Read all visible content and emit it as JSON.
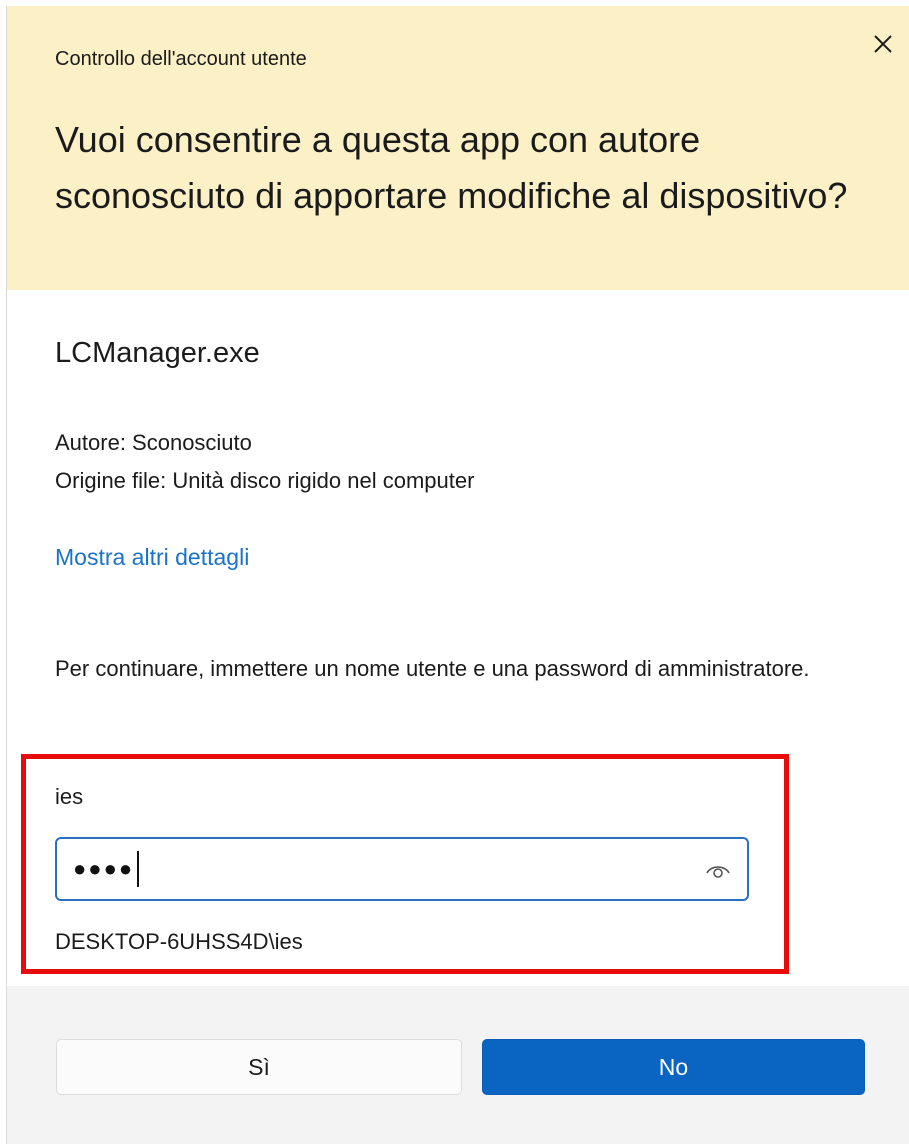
{
  "dialog": {
    "caption": "Controllo dell'account utente",
    "question": "Vuoi consentire a questa app con autore sconosciuto di apportare modifiche al dispositivo?",
    "close_icon": "close-icon",
    "app_name": "LCManager.exe",
    "publisher": "Autore: Sconosciuto",
    "file_origin": "Origine file: Unità disco rigido nel computer",
    "details_link": "Mostra altri dettagli",
    "instructions": "Per continuare, immettere un nome utente e una password di amministratore."
  },
  "credentials": {
    "username": "ies",
    "password_mask": "●●●●",
    "reveal_icon": "eye-icon",
    "domain": "DESKTOP-6UHSS4D\\ies",
    "highlight_color": "#e80b0b"
  },
  "buttons": {
    "yes_label": "Sì",
    "no_label": "No"
  },
  "colors": {
    "header_bg": "#fbf0c6",
    "link": "#1a73c9",
    "primary_button": "#0a64c2",
    "focus_border": "#2a70c0"
  }
}
